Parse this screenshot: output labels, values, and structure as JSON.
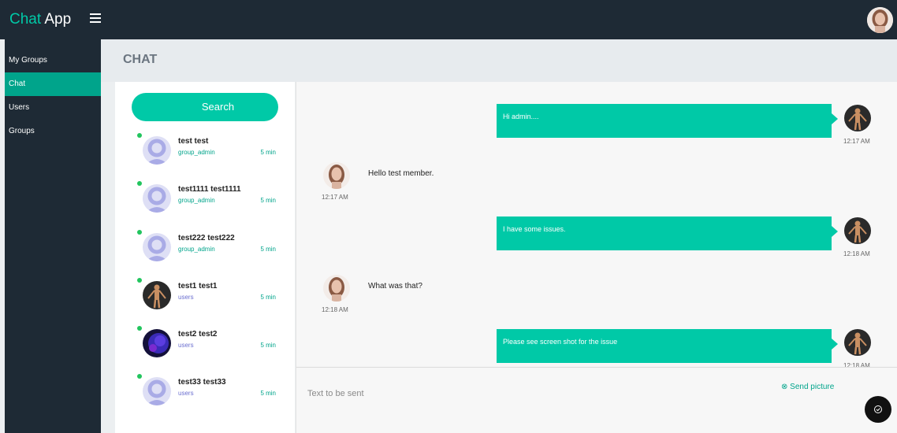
{
  "app": {
    "title_accent": "Chat",
    "title_rest": "App"
  },
  "sidebar": {
    "items": [
      {
        "label": "My Groups",
        "active": false
      },
      {
        "label": "Chat",
        "active": true
      },
      {
        "label": "Users",
        "active": false
      },
      {
        "label": "Groups",
        "active": false
      }
    ]
  },
  "header": {
    "title": "CHAT"
  },
  "contacts": {
    "search_label": "Search",
    "items": [
      {
        "name": "test test",
        "role": "group_admin",
        "time": "5 min",
        "online": true
      },
      {
        "name": "test1111 test1111",
        "role": "group_admin",
        "time": "5 min",
        "online": true
      },
      {
        "name": "test222 test222",
        "role": "group_admin",
        "time": "5 min",
        "online": true
      },
      {
        "name": "test1 test1",
        "role": "users",
        "time": "5 min",
        "online": true
      },
      {
        "name": "test2 test2",
        "role": "users",
        "time": "5 min",
        "online": true
      },
      {
        "name": "test33 test33",
        "role": "users",
        "time": "5 min",
        "online": true
      }
    ]
  },
  "messages": [
    {
      "direction": "outgoing",
      "text": "Hi admin....",
      "time": "12:17 AM"
    },
    {
      "direction": "incoming",
      "text": "Hello test member.",
      "time": "12:17 AM"
    },
    {
      "direction": "outgoing",
      "text": "I have some issues.",
      "time": "12:18 AM"
    },
    {
      "direction": "incoming",
      "text": "What was that?",
      "time": "12:18 AM"
    },
    {
      "direction": "outgoing",
      "text": "Please see screen shot for the issue",
      "time": "12:18 AM"
    }
  ],
  "compose": {
    "placeholder": "Text to be sent",
    "send_picture_label": "Send picture"
  },
  "colors": {
    "accent": "#00c9a7",
    "accent_dark": "#00a48b",
    "nav_bg": "#1e2a35",
    "online": "#22c55e"
  }
}
